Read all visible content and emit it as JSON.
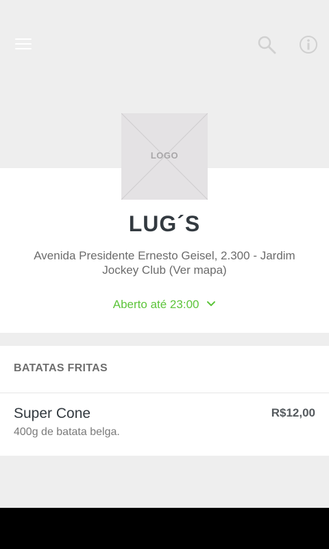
{
  "header": {
    "menu_icon": "hamburger-icon",
    "search_icon": "search-icon",
    "info_icon": "info-icon"
  },
  "store": {
    "logo_text": "LOGO",
    "name": "LUG´S",
    "address": "Avenida Presidente Ernesto Geisel, 2.300 - Jardim Jockey Club (Ver mapa)",
    "hours": "Aberto até 23:00",
    "accent_color": "#5cc43a"
  },
  "menu": {
    "section_title": "BATATAS FRITAS",
    "items": [
      {
        "name": "Super Cone",
        "description": "400g de batata belga.",
        "price": "R$12,00"
      }
    ]
  }
}
